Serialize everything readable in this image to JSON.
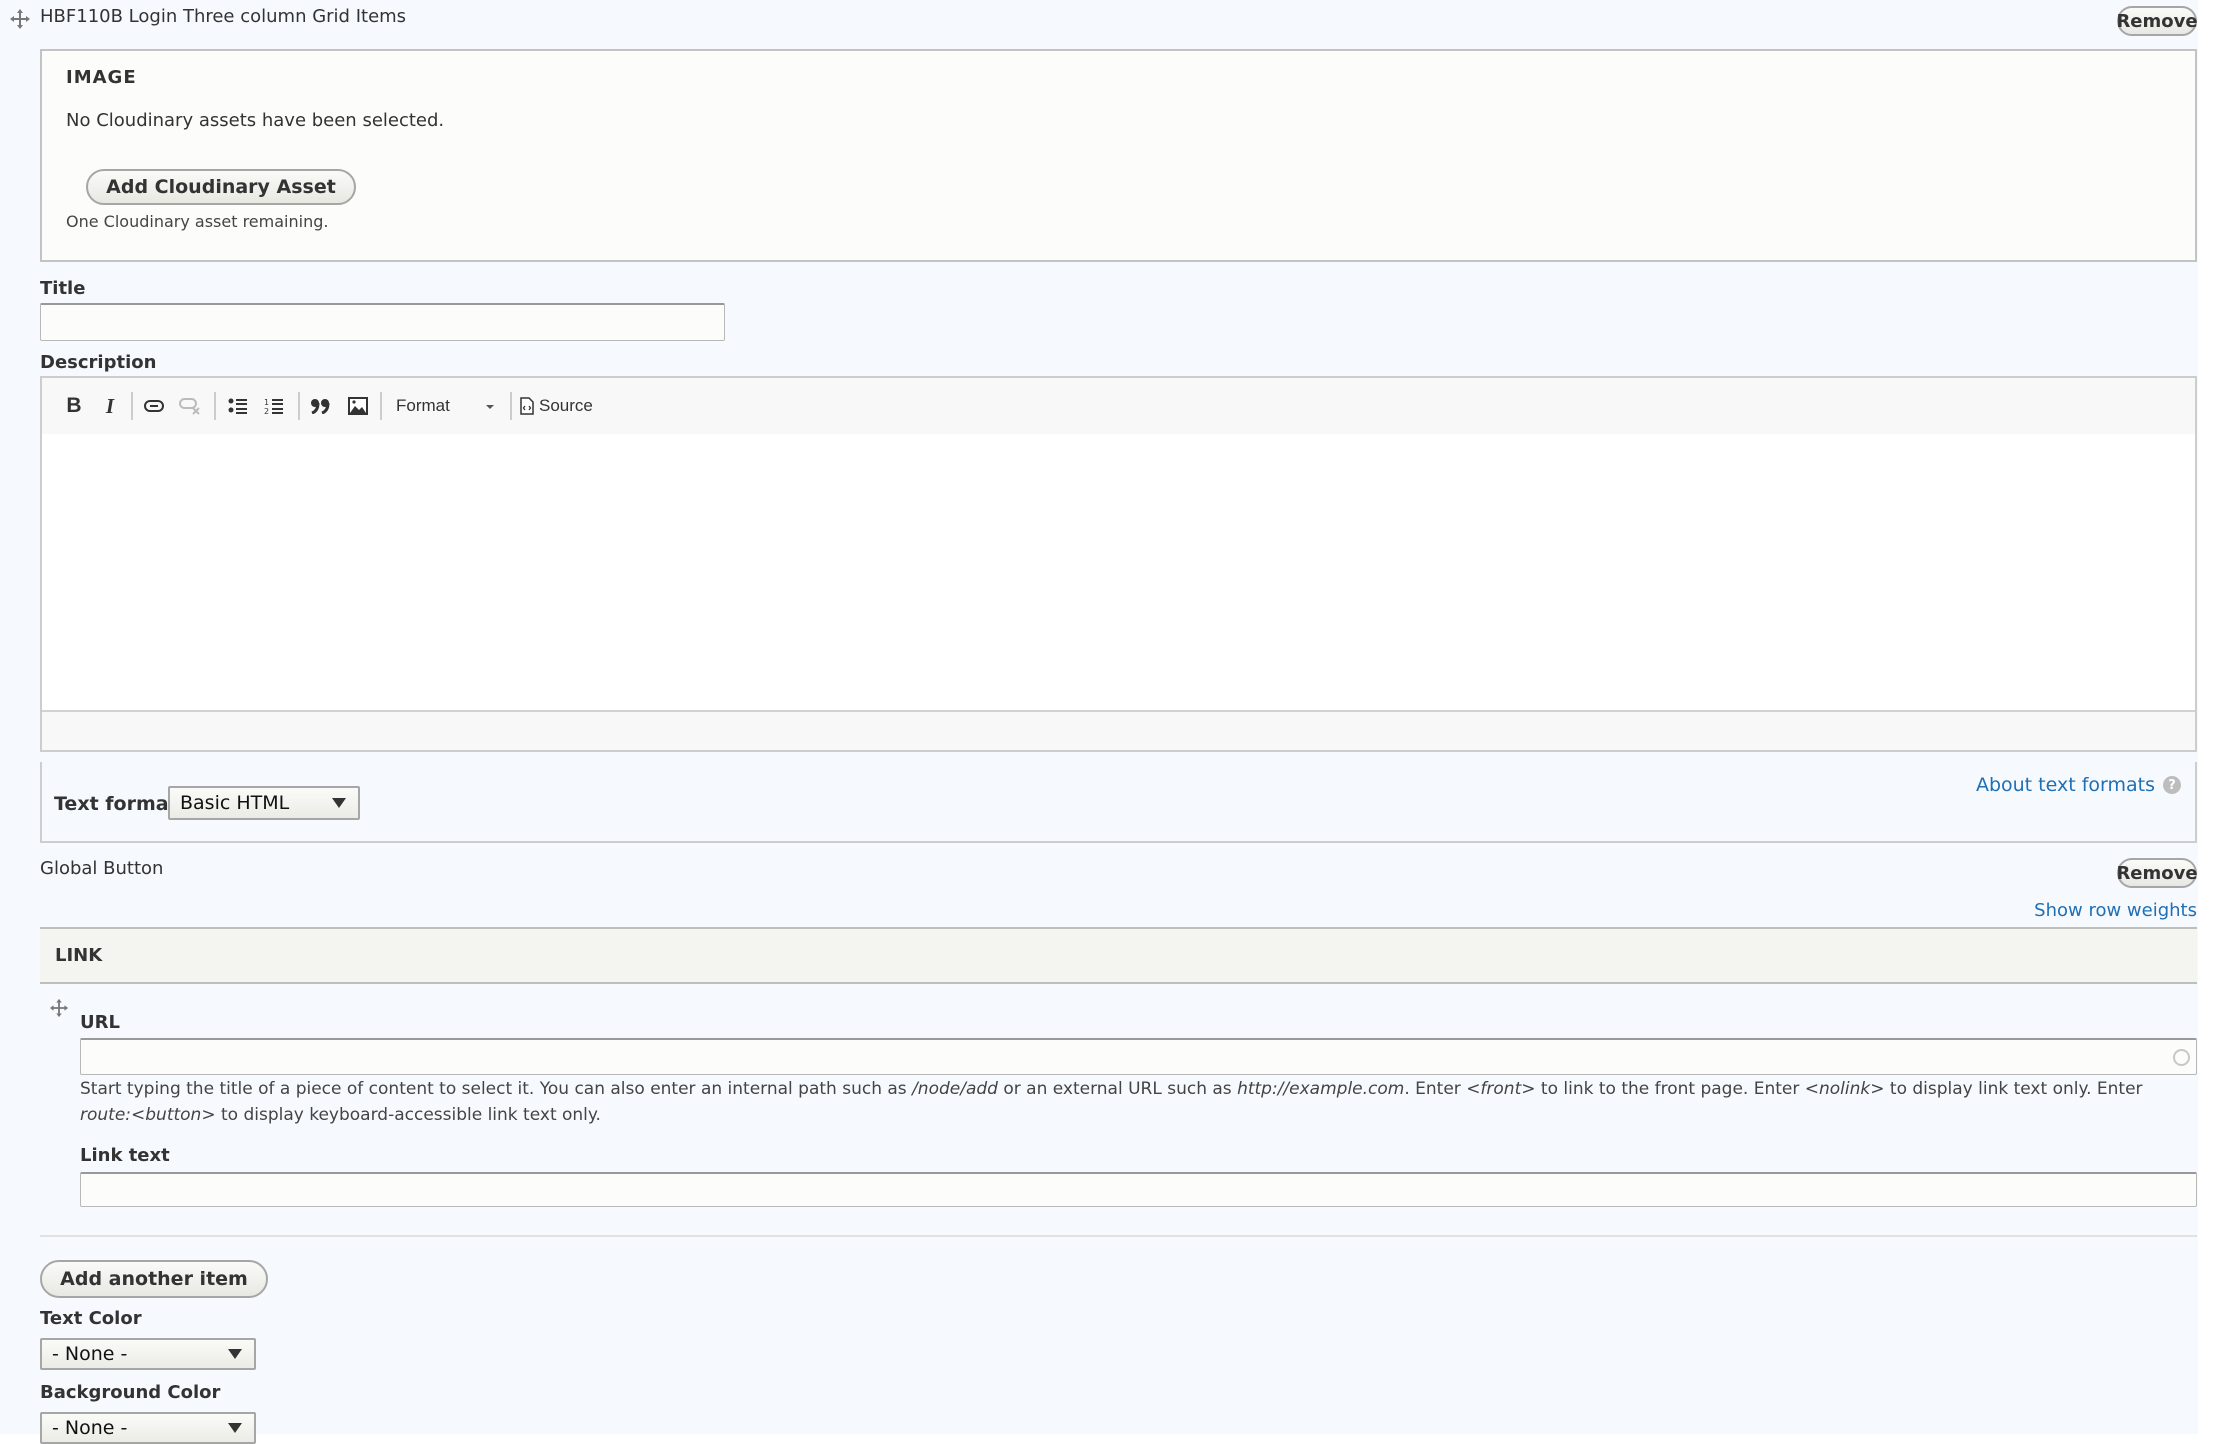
{
  "paragraph": {
    "title": "HBF110B Login Three column Grid Items",
    "remove_label": "Remove"
  },
  "image_section": {
    "legend": "IMAGE",
    "status": "No Cloudinary assets have been selected.",
    "add_button": "Add Cloudinary Asset",
    "remaining": "One Cloudinary asset remaining."
  },
  "title_field": {
    "label": "Title",
    "value": ""
  },
  "description": {
    "label": "Description",
    "toolbar": {
      "bold": "B",
      "italic": "I",
      "format_label": "Format",
      "source_label": "Source"
    },
    "content": "",
    "text_format_label": "Text format",
    "text_format_value": "Basic HTML",
    "about_link": "About text formats"
  },
  "global_button": {
    "label": "Global Button",
    "remove_label": "Remove",
    "row_weights_link": "Show row weights",
    "table_header": "LINK",
    "url_label": "URL",
    "url_value": "",
    "help_parts": [
      "Start typing the title of a piece of content to select it. You can also enter an internal path such as ",
      "/node/add",
      " or an external URL such as ",
      "http://example.com",
      ". Enter ",
      "<front>",
      " to link to the front page. Enter ",
      "<nolink>",
      " to display link text only. Enter ",
      "route:<button>",
      " to display keyboard-accessible link text only."
    ],
    "link_text_label": "Link text",
    "link_text_value": "",
    "add_another": "Add another item"
  },
  "text_color": {
    "label": "Text Color",
    "value": "- None -"
  },
  "background_color": {
    "label": "Background Color",
    "value": "- None -"
  },
  "colors": {
    "link": "#1f6fb5",
    "page_bg": "#f6faff"
  }
}
